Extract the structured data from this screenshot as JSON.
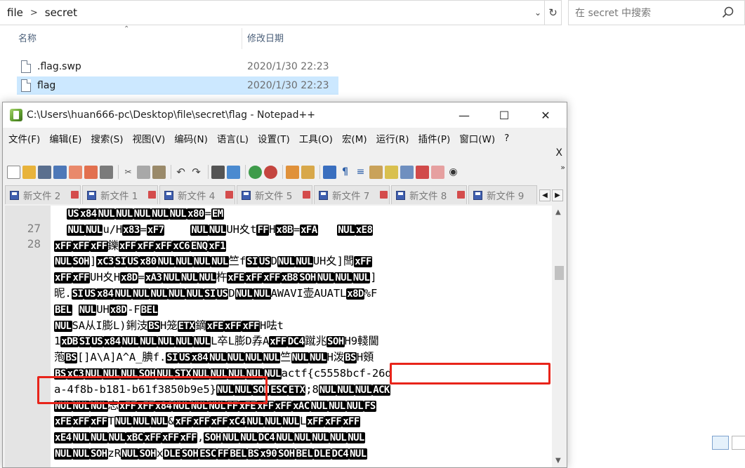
{
  "explorer": {
    "breadcrumb": [
      "file",
      "secret"
    ],
    "search_placeholder": "在 secret 中搜索",
    "col_name": "名称",
    "col_date": "修改日期",
    "files": [
      {
        "name": ".flag.swp",
        "date": "2020/1/30 22:23"
      },
      {
        "name": "flag",
        "date": "2020/1/30 22:23"
      }
    ]
  },
  "notepad": {
    "title": "C:\\Users\\huan666-pc\\Desktop\\file\\secret\\flag - Notepad++",
    "menu": [
      "文件(F)",
      "编辑(E)",
      "搜索(S)",
      "视图(V)",
      "编码(N)",
      "语言(L)",
      "设置(T)",
      "工具(O)",
      "宏(M)",
      "运行(R)",
      "插件(P)",
      "窗口(W)",
      "?"
    ],
    "menu_close": "X",
    "tabs": [
      {
        "label": "新文件 2"
      },
      {
        "label": "新文件 1"
      },
      {
        "label": "新文件 4"
      },
      {
        "label": "新文件 5"
      },
      {
        "label": "新文件 7"
      },
      {
        "label": "新文件 8"
      },
      {
        "label": "新文件 9"
      }
    ],
    "line_numbers": [
      "27",
      "28"
    ],
    "flag_text": "actf{c5558bcf-26da-4f8b-b181-b61f3850b9e5}"
  },
  "colors": {
    "highlight": "#e8241a",
    "tab_icon": "#3f5fb0",
    "selected_row": "#cce8ff"
  }
}
